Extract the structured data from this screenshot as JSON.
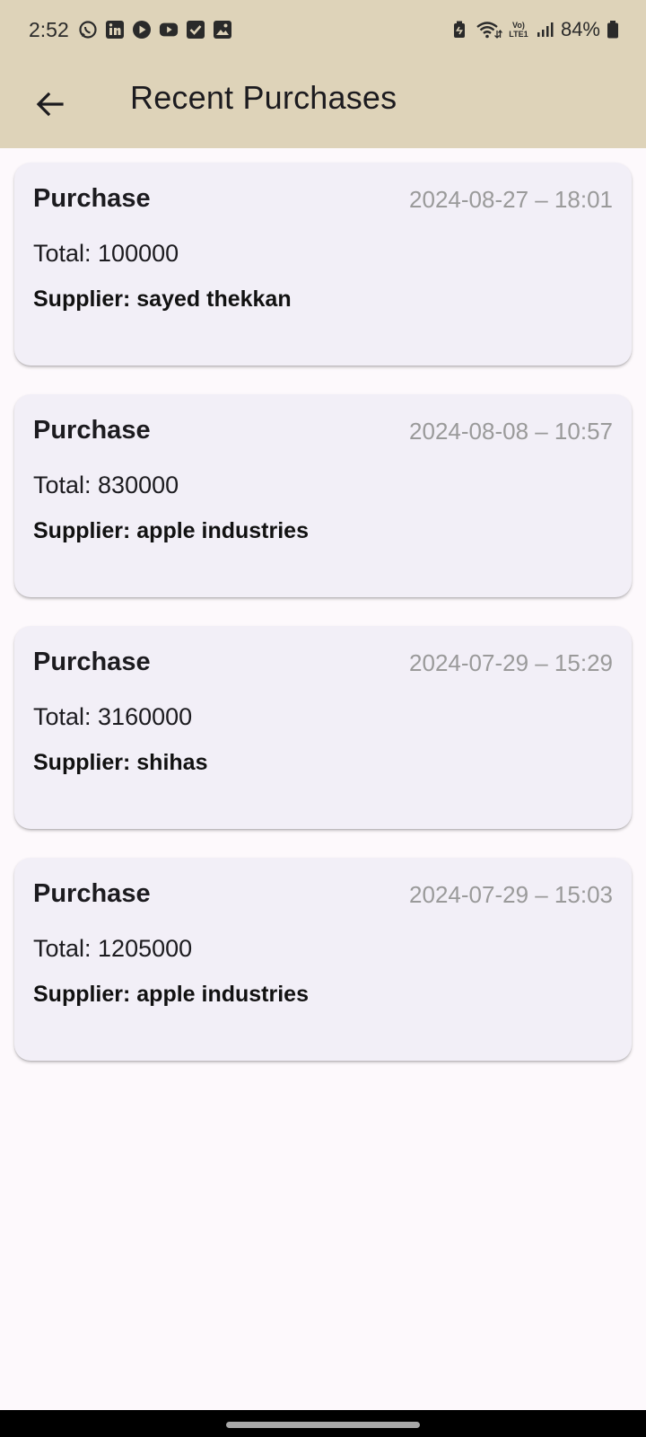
{
  "status_bar": {
    "time": "2:52",
    "battery": "84%",
    "left_icons": [
      "whatsapp-icon",
      "linkedin-icon",
      "play-icon",
      "youtube-icon",
      "checkbox-icon",
      "gallery-icon"
    ],
    "right_icons": [
      "battery-saver-icon",
      "wifi-icon",
      "volte-icon",
      "signal-icon",
      "battery-icon"
    ],
    "volte_label": "Vo) LTE1"
  },
  "app_bar": {
    "title": "Recent Purchases",
    "background": "#ded3b9"
  },
  "purchases": [
    {
      "title": "Purchase",
      "date": "2024-08-27 – 18:01",
      "total": "Total: 100000",
      "supplier": "Supplier: sayed thekkan"
    },
    {
      "title": "Purchase",
      "date": "2024-08-08 – 10:57",
      "total": "Total: 830000",
      "supplier": "Supplier: apple industries"
    },
    {
      "title": "Purchase",
      "date": "2024-07-29 – 15:29",
      "total": "Total: 3160000",
      "supplier": "Supplier: shihas"
    },
    {
      "title": "Purchase",
      "date": "2024-07-29 – 15:03",
      "total": "Total: 1205000",
      "supplier": "Supplier: apple industries"
    }
  ]
}
